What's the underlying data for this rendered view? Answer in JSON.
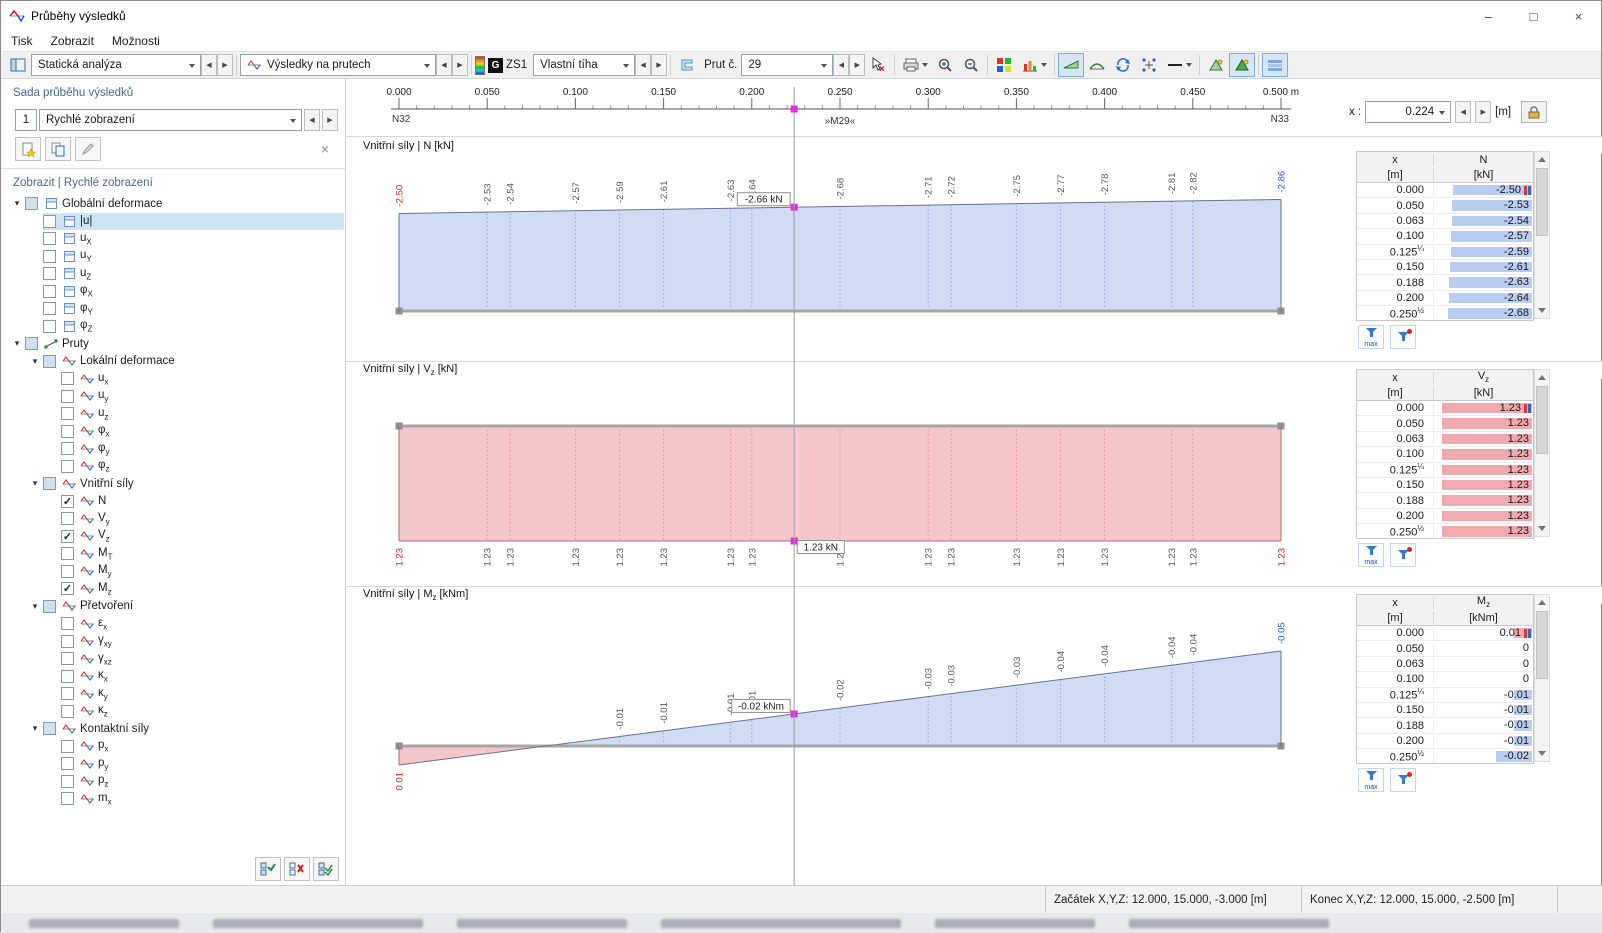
{
  "window": {
    "title": "Průběhy výsledků",
    "controls": {
      "min": "–",
      "max": "□",
      "close": "×"
    }
  },
  "menu": {
    "items": [
      {
        "label": "Tisk"
      },
      {
        "label": "Zobrazit"
      },
      {
        "label": "Možnosti"
      }
    ]
  },
  "toolbar": {
    "analysis": "Statická analýza",
    "result_type": "Výsledky na prutech",
    "lc_badge": "G",
    "lc_id": "ZS1",
    "lc_name": "Vlastní tíha",
    "member_label": "Prut č.",
    "member_value": "29"
  },
  "sidebar": {
    "header": "Sada průběhu výsledků",
    "set_number": "1",
    "set_name": "Rychlé zobrazení",
    "tree_header": "Zobrazit | Rychlé zobrazení",
    "tree": [
      {
        "type": "parent",
        "depth": 0,
        "label": "Globální deformace",
        "cb": "mixed",
        "icon": "page"
      },
      {
        "type": "leaf",
        "depth": 1,
        "label": "|u|",
        "cb": "off",
        "icon": "page",
        "selected": true
      },
      {
        "type": "leaf",
        "depth": 1,
        "label": "u",
        "sub": "X",
        "cb": "off",
        "icon": "page"
      },
      {
        "type": "leaf",
        "depth": 1,
        "label": "u",
        "sub": "Y",
        "cb": "off",
        "icon": "page"
      },
      {
        "type": "leaf",
        "depth": 1,
        "label": "u",
        "sub": "Z",
        "cb": "off",
        "icon": "page"
      },
      {
        "type": "leaf",
        "depth": 1,
        "label": "φ",
        "sub": "X",
        "cb": "off",
        "icon": "page"
      },
      {
        "type": "leaf",
        "depth": 1,
        "label": "φ",
        "sub": "Y",
        "cb": "off",
        "icon": "page"
      },
      {
        "type": "leaf",
        "depth": 1,
        "label": "φ",
        "sub": "Z",
        "cb": "off",
        "icon": "page"
      },
      {
        "type": "parent",
        "depth": 0,
        "label": "Pruty",
        "cb": "mixed",
        "icon": "member"
      },
      {
        "type": "parent",
        "depth": 1,
        "label": "Lokální deformace",
        "cb": "mixed",
        "icon": "diagram"
      },
      {
        "type": "leaf",
        "depth": 2,
        "label": "u",
        "sub": "x",
        "cb": "off",
        "icon": "diagram"
      },
      {
        "type": "leaf",
        "depth": 2,
        "label": "u",
        "sub": "y",
        "cb": "off",
        "icon": "diagram"
      },
      {
        "type": "leaf",
        "depth": 2,
        "label": "u",
        "sub": "z",
        "cb": "off",
        "icon": "diagram"
      },
      {
        "type": "leaf",
        "depth": 2,
        "label": "φ",
        "sub": "x",
        "cb": "off",
        "icon": "diagram"
      },
      {
        "type": "leaf",
        "depth": 2,
        "label": "φ",
        "sub": "y",
        "cb": "off",
        "icon": "diagram"
      },
      {
        "type": "leaf",
        "depth": 2,
        "label": "φ",
        "sub": "z",
        "cb": "off",
        "icon": "diagram"
      },
      {
        "type": "parent",
        "depth": 1,
        "label": "Vnitřní síly",
        "cb": "mixed",
        "icon": "diagram"
      },
      {
        "type": "leaf",
        "depth": 2,
        "label": "N",
        "cb": "on",
        "icon": "diagram"
      },
      {
        "type": "leaf",
        "depth": 2,
        "label": "V",
        "sub": "y",
        "cb": "off",
        "icon": "diagram"
      },
      {
        "type": "leaf",
        "depth": 2,
        "label": "V",
        "sub": "z",
        "cb": "on",
        "icon": "diagram"
      },
      {
        "type": "leaf",
        "depth": 2,
        "label": "M",
        "sub": "T",
        "cb": "off",
        "icon": "diagram"
      },
      {
        "type": "leaf",
        "depth": 2,
        "label": "M",
        "sub": "y",
        "cb": "off",
        "icon": "diagram"
      },
      {
        "type": "leaf",
        "depth": 2,
        "label": "M",
        "sub": "z",
        "cb": "on",
        "icon": "diagram"
      },
      {
        "type": "parent",
        "depth": 1,
        "label": "Přetvoření",
        "cb": "mixed",
        "icon": "diagram"
      },
      {
        "type": "leaf",
        "depth": 2,
        "label": "ε",
        "sub": "x",
        "cb": "off",
        "icon": "diagram"
      },
      {
        "type": "leaf",
        "depth": 2,
        "label": "γ",
        "sub": "xy",
        "cb": "off",
        "icon": "diagram"
      },
      {
        "type": "leaf",
        "depth": 2,
        "label": "γ",
        "sub": "xz",
        "cb": "off",
        "icon": "diagram"
      },
      {
        "type": "leaf",
        "depth": 2,
        "label": "κ",
        "sub": "x",
        "cb": "off",
        "icon": "diagram"
      },
      {
        "type": "leaf",
        "depth": 2,
        "label": "κ",
        "sub": "y",
        "cb": "off",
        "icon": "diagram"
      },
      {
        "type": "leaf",
        "depth": 2,
        "label": "κ",
        "sub": "z",
        "cb": "off",
        "icon": "diagram"
      },
      {
        "type": "parent",
        "depth": 1,
        "label": "Kontaktní síly",
        "cb": "mixed",
        "icon": "diagram"
      },
      {
        "type": "leaf",
        "depth": 2,
        "label": "p",
        "sub": "x",
        "cb": "off",
        "icon": "diagram"
      },
      {
        "type": "leaf",
        "depth": 2,
        "label": "p",
        "sub": "y",
        "cb": "off",
        "icon": "diagram"
      },
      {
        "type": "leaf",
        "depth": 2,
        "label": "p",
        "sub": "z",
        "cb": "off",
        "icon": "diagram"
      },
      {
        "type": "leaf",
        "depth": 2,
        "label": "m",
        "sub": "x",
        "cb": "off",
        "icon": "diagram"
      }
    ]
  },
  "ruler": {
    "ticks": [
      "0.000",
      "0.050",
      "0.100",
      "0.150",
      "0.200",
      "0.250",
      "0.300",
      "0.350",
      "0.400",
      "0.450",
      "0.500 m"
    ],
    "node_start": "N32",
    "member": "»M29«",
    "node_end": "N33",
    "x_label": "x :",
    "x_value": "0.224",
    "x_unit": "[m]"
  },
  "tables_ui": {
    "max_label": "max"
  },
  "colors": {
    "positive_fill": "#f5c7ca",
    "negative_fill": "#cfdcf3",
    "positive_edge": "#b26b6f",
    "negative_edge": "#64748f",
    "positive_dot": "#d39297",
    "negative_dot": "#92a9d2",
    "bar_positive": "#f0a9ae",
    "bar_negative": "#b9cdf0",
    "cursor_marker": "#e02ee0",
    "label_max": "#cc2222",
    "label_min": "#2255cc"
  },
  "chart_data": [
    {
      "type": "area",
      "group": "Vnitřní síly",
      "symbol": "N",
      "sub": "",
      "v_unit": "[kN]",
      "x_label": "x",
      "x_unit": "[m]",
      "xlim": [
        0,
        0.5
      ],
      "x": [
        0.0,
        0.05,
        0.063,
        0.1,
        0.125,
        0.15,
        0.188,
        0.2,
        0.25,
        0.3,
        0.313,
        0.35,
        0.375,
        0.4,
        0.438,
        0.45,
        0.5
      ],
      "values": [
        -2.5,
        -2.53,
        -2.54,
        -2.57,
        -2.59,
        -2.61,
        -2.63,
        -2.64,
        -2.68,
        -2.71,
        -2.72,
        -2.75,
        -2.77,
        -2.78,
        -2.81,
        -2.82,
        -2.86
      ],
      "skip_zero_labels": false,
      "cursor": {
        "x": 0.224,
        "label": "-2.66 kN"
      },
      "table_rows": [
        {
          "x": "0.000",
          "v": "-2.50",
          "marker": true
        },
        {
          "x": "0.050",
          "v": "-2.53"
        },
        {
          "x": "0.063",
          "v": "-2.54"
        },
        {
          "x": "0.100",
          "v": "-2.57"
        },
        {
          "x": "0.125",
          "sup": "¼",
          "v": "-2.59"
        },
        {
          "x": "0.150",
          "v": "-2.61"
        },
        {
          "x": "0.188",
          "v": "-2.63"
        },
        {
          "x": "0.200",
          "v": "-2.64"
        },
        {
          "x": "0.250",
          "sup": "½",
          "v": "-2.68"
        }
      ]
    },
    {
      "type": "area",
      "group": "Vnitřní síly",
      "symbol": "V",
      "sub": "z",
      "v_unit": "[kN]",
      "x_label": "x",
      "x_unit": "[m]",
      "xlim": [
        0,
        0.5
      ],
      "x": [
        0.0,
        0.05,
        0.063,
        0.1,
        0.125,
        0.15,
        0.188,
        0.2,
        0.25,
        0.3,
        0.313,
        0.35,
        0.375,
        0.4,
        0.438,
        0.45,
        0.5
      ],
      "values": [
        1.23,
        1.23,
        1.23,
        1.23,
        1.23,
        1.23,
        1.23,
        1.23,
        1.23,
        1.23,
        1.23,
        1.23,
        1.23,
        1.23,
        1.23,
        1.23,
        1.23
      ],
      "skip_zero_labels": false,
      "cursor": {
        "x": 0.224,
        "label": "1.23 kN"
      },
      "table_rows": [
        {
          "x": "0.000",
          "v": "1.23",
          "marker": true
        },
        {
          "x": "0.050",
          "v": "1.23"
        },
        {
          "x": "0.063",
          "v": "1.23"
        },
        {
          "x": "0.100",
          "v": "1.23"
        },
        {
          "x": "0.125",
          "sup": "¼",
          "v": "1.23"
        },
        {
          "x": "0.150",
          "v": "1.23"
        },
        {
          "x": "0.188",
          "v": "1.23"
        },
        {
          "x": "0.200",
          "v": "1.23"
        },
        {
          "x": "0.250",
          "sup": "½",
          "v": "1.23"
        }
      ]
    },
    {
      "type": "area",
      "group": "Vnitřní síly",
      "symbol": "M",
      "sub": "z",
      "v_unit": "[kNm]",
      "x_label": "x",
      "x_unit": "[m]",
      "xlim": [
        0,
        0.5
      ],
      "x": [
        0.0,
        0.05,
        0.063,
        0.1,
        0.125,
        0.15,
        0.188,
        0.2,
        0.25,
        0.3,
        0.313,
        0.35,
        0.375,
        0.4,
        0.438,
        0.45,
        0.5
      ],
      "values": [
        0.01,
        0,
        0,
        0,
        -0.01,
        -0.01,
        -0.01,
        -0.01,
        -0.02,
        -0.03,
        -0.03,
        -0.03,
        -0.04,
        -0.04,
        -0.04,
        -0.04,
        -0.05
      ],
      "skip_zero_labels": true,
      "cursor": {
        "x": 0.224,
        "label": "-0.02 kNm"
      },
      "table_rows": [
        {
          "x": "0.000",
          "v": "0.01",
          "marker": true
        },
        {
          "x": "0.050",
          "v": "0"
        },
        {
          "x": "0.063",
          "v": "0"
        },
        {
          "x": "0.100",
          "v": "0"
        },
        {
          "x": "0.125",
          "sup": "¼",
          "v": "-0.01"
        },
        {
          "x": "0.150",
          "v": "-0.01"
        },
        {
          "x": "0.188",
          "v": "-0.01"
        },
        {
          "x": "0.200",
          "v": "-0.01"
        },
        {
          "x": "0.250",
          "sup": "½",
          "v": "-0.02"
        }
      ]
    }
  ],
  "status": {
    "start": "Začátek X,Y,Z: 12.000, 15.000, -3.000 [m]",
    "end": "Konec X,Y,Z: 12.000, 15.000, -2.500 [m]"
  }
}
